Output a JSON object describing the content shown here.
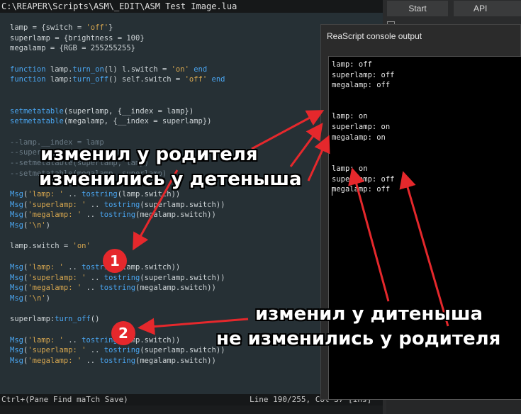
{
  "editor": {
    "title": "C:\\REAPER\\Scripts\\ASM\\_EDIT\\ASM Test Image.lua",
    "code_lines": [
      [
        {
          "t": "lamp = {switch = ",
          "c": ""
        },
        {
          "t": "'off'",
          "c": "str"
        },
        {
          "t": "}",
          "c": ""
        }
      ],
      [
        {
          "t": "superlamp = {brightness = 100}",
          "c": ""
        }
      ],
      [
        {
          "t": "megalamp = {RGB = 255255255}",
          "c": ""
        }
      ],
      [],
      [
        {
          "t": "function",
          "c": "kw"
        },
        {
          "t": " lamp.",
          "c": ""
        },
        {
          "t": "turn_on",
          "c": "fn"
        },
        {
          "t": "(l) l.switch = ",
          "c": ""
        },
        {
          "t": "'on'",
          "c": "str"
        },
        {
          "t": " ",
          "c": ""
        },
        {
          "t": "end",
          "c": "kw"
        }
      ],
      [
        {
          "t": "function",
          "c": "kw"
        },
        {
          "t": " lamp:",
          "c": ""
        },
        {
          "t": "turn_off",
          "c": "fn"
        },
        {
          "t": "() self.switch = ",
          "c": ""
        },
        {
          "t": "'off'",
          "c": "str"
        },
        {
          "t": " ",
          "c": ""
        },
        {
          "t": "end",
          "c": "kw"
        }
      ],
      [],
      [],
      [
        {
          "t": "setmetatable",
          "c": "fn"
        },
        {
          "t": "(superlamp, {__index = lamp})",
          "c": ""
        }
      ],
      [
        {
          "t": "setmetatable",
          "c": "fn"
        },
        {
          "t": "(megalamp, {__index = superlamp})",
          "c": ""
        }
      ],
      [],
      [
        {
          "t": "--lamp.__index = lamp",
          "c": "cmt"
        }
      ],
      [
        {
          "t": "--superlamp.__index = lamp",
          "c": "cmt"
        }
      ],
      [
        {
          "t": "--setmetatable(superlamp, lamp)",
          "c": "cmt"
        }
      ],
      [
        {
          "t": "--setmetatable(megalamp, superlamp)",
          "c": "cmt"
        }
      ],
      [],
      [
        {
          "t": "Msg",
          "c": "fn"
        },
        {
          "t": "(",
          "c": ""
        },
        {
          "t": "'lamp: '",
          "c": "str"
        },
        {
          "t": " .. ",
          "c": ""
        },
        {
          "t": "tostring",
          "c": "fn"
        },
        {
          "t": "(lamp.switch))",
          "c": ""
        }
      ],
      [
        {
          "t": "Msg",
          "c": "fn"
        },
        {
          "t": "(",
          "c": ""
        },
        {
          "t": "'superlamp: '",
          "c": "str"
        },
        {
          "t": " .. ",
          "c": ""
        },
        {
          "t": "tostring",
          "c": "fn"
        },
        {
          "t": "(superlamp.switch))",
          "c": ""
        }
      ],
      [
        {
          "t": "Msg",
          "c": "fn"
        },
        {
          "t": "(",
          "c": ""
        },
        {
          "t": "'megalamp: '",
          "c": "str"
        },
        {
          "t": " .. ",
          "c": ""
        },
        {
          "t": "tostring",
          "c": "fn"
        },
        {
          "t": "(megalamp.switch))",
          "c": ""
        }
      ],
      [
        {
          "t": "Msg",
          "c": "fn"
        },
        {
          "t": "(",
          "c": ""
        },
        {
          "t": "'\\n'",
          "c": "str"
        },
        {
          "t": ")",
          "c": ""
        }
      ],
      [],
      [
        {
          "t": "lamp.switch = ",
          "c": ""
        },
        {
          "t": "'on'",
          "c": "str"
        }
      ],
      [],
      [
        {
          "t": "Msg",
          "c": "fn"
        },
        {
          "t": "(",
          "c": ""
        },
        {
          "t": "'lamp: '",
          "c": "str"
        },
        {
          "t": " .. ",
          "c": ""
        },
        {
          "t": "tostring",
          "c": "fn"
        },
        {
          "t": "(lamp.switch))",
          "c": ""
        }
      ],
      [
        {
          "t": "Msg",
          "c": "fn"
        },
        {
          "t": "(",
          "c": ""
        },
        {
          "t": "'superlamp: '",
          "c": "str"
        },
        {
          "t": " .. ",
          "c": ""
        },
        {
          "t": "tostring",
          "c": "fn"
        },
        {
          "t": "(superlamp.switch))",
          "c": ""
        }
      ],
      [
        {
          "t": "Msg",
          "c": "fn"
        },
        {
          "t": "(",
          "c": ""
        },
        {
          "t": "'megalamp: '",
          "c": "str"
        },
        {
          "t": " .. ",
          "c": ""
        },
        {
          "t": "tostring",
          "c": "fn"
        },
        {
          "t": "(megalamp.switch))",
          "c": ""
        }
      ],
      [
        {
          "t": "Msg",
          "c": "fn"
        },
        {
          "t": "(",
          "c": ""
        },
        {
          "t": "'\\n'",
          "c": "str"
        },
        {
          "t": ")",
          "c": ""
        }
      ],
      [],
      [
        {
          "t": "superlamp:",
          "c": ""
        },
        {
          "t": "turn_off",
          "c": "fn"
        },
        {
          "t": "()",
          "c": ""
        }
      ],
      [],
      [
        {
          "t": "Msg",
          "c": "fn"
        },
        {
          "t": "(",
          "c": ""
        },
        {
          "t": "'lamp: '",
          "c": "str"
        },
        {
          "t": " .. ",
          "c": ""
        },
        {
          "t": "tostring",
          "c": "fn"
        },
        {
          "t": "(lamp.switch))",
          "c": ""
        }
      ],
      [
        {
          "t": "Msg",
          "c": "fn"
        },
        {
          "t": "(",
          "c": ""
        },
        {
          "t": "'superlamp: '",
          "c": "str"
        },
        {
          "t": " .. ",
          "c": ""
        },
        {
          "t": "tostring",
          "c": "fn"
        },
        {
          "t": "(superlamp.switch))",
          "c": ""
        }
      ],
      [
        {
          "t": "Msg",
          "c": "fn"
        },
        {
          "t": "(",
          "c": ""
        },
        {
          "t": "'megalamp: '",
          "c": "str"
        },
        {
          "t": " .. ",
          "c": ""
        },
        {
          "t": "tostring",
          "c": "fn"
        },
        {
          "t": "(megalamp.switch))",
          "c": ""
        }
      ]
    ],
    "status_left": "Ctrl+(Pane Find maTch Save)",
    "status_right": "Line 190/255, Col 37 [ins]"
  },
  "background_app": {
    "tab_start": "Start",
    "tab_api": "API"
  },
  "console": {
    "title": "ReaScript console output",
    "lines": [
      "lamp: off",
      "superlamp: off",
      "megalamp: off",
      "",
      "",
      "lamp: on",
      "superlamp: on",
      "megalamp: on",
      "",
      "",
      "lamp: on",
      "superlamp: off",
      "megalamp: off"
    ]
  },
  "annotations": {
    "text_parent_changed": "изменил у родителя",
    "text_children_changed": "изменились у детеныша",
    "text_child_changed": "изменил у дитеныша",
    "text_parent_not_changed": "не изменились у родителя",
    "badge_1": "1",
    "badge_2": "2",
    "arrow_color": "#e5282c"
  },
  "colors": {
    "editor_bg": "#263035",
    "console_bg": "#000000",
    "keyword": "#4aa5f0",
    "string": "#d6a64f"
  }
}
